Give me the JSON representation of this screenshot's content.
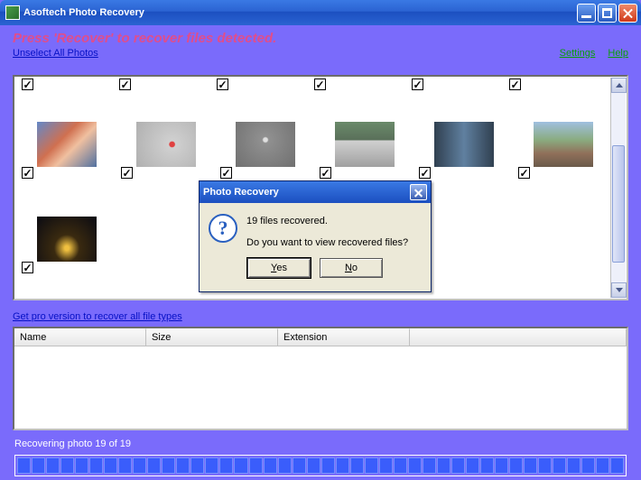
{
  "titlebar": {
    "title": "Asoftech Photo Recovery"
  },
  "instruction": "Press 'Recover' to recover files detected.",
  "links": {
    "unselect": "Unselect All Photos",
    "settings": "Settings",
    "help": "Help",
    "pro": "Get pro version to recover all file types"
  },
  "table": {
    "cols": {
      "name": "Name",
      "size": "Size",
      "ext": "Extension"
    }
  },
  "status": "Recovering photo 19 of 19",
  "progress": {
    "segments": 42
  },
  "dialog": {
    "title": "Photo Recovery",
    "line1": "19 files recovered.",
    "line2": "Do you want to view recovered files?",
    "yes": "Yes",
    "no": "No"
  },
  "thumbs": {
    "row1": 6,
    "names": [
      "crowd-photo",
      "runner-photo",
      "runner2-photo",
      "car-photo",
      "athlete-photo",
      "park-photo"
    ],
    "row2name": "night-photo"
  }
}
